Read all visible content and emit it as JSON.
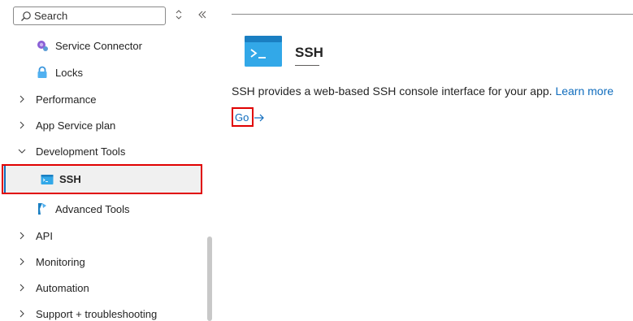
{
  "search": {
    "placeholder": "Search"
  },
  "toolbar": {
    "sort_icon": "up-down-icon",
    "collapse_icon": "double-chevron-left-icon"
  },
  "sidebar": {
    "items": [
      {
        "label": "Service Connector",
        "icon": "service-connector-icon",
        "child": true
      },
      {
        "label": "Locks",
        "icon": "lock-icon",
        "child": true
      },
      {
        "label": "Performance",
        "expandable": true,
        "expanded": false
      },
      {
        "label": "App Service plan",
        "expandable": true,
        "expanded": false
      },
      {
        "label": "Development Tools",
        "expandable": true,
        "expanded": true
      },
      {
        "label": "SSH",
        "icon": "ssh-icon",
        "child": true,
        "selected": true
      },
      {
        "label": "Advanced Tools",
        "icon": "advanced-tools-icon",
        "child": true
      },
      {
        "label": "API",
        "expandable": true,
        "expanded": false
      },
      {
        "label": "Monitoring",
        "expandable": true,
        "expanded": false
      },
      {
        "label": "Automation",
        "expandable": true,
        "expanded": false
      },
      {
        "label": "Support + troubleshooting",
        "expandable": true,
        "expanded": false
      }
    ]
  },
  "main": {
    "title": "SSH",
    "description": "SSH provides a web-based SSH console interface for your app.",
    "learn_more": "Learn more",
    "go_label": "Go"
  },
  "colors": {
    "accent": "#0f6cbd",
    "highlight": "#e00000",
    "selected_bg": "#f0f0f0"
  }
}
